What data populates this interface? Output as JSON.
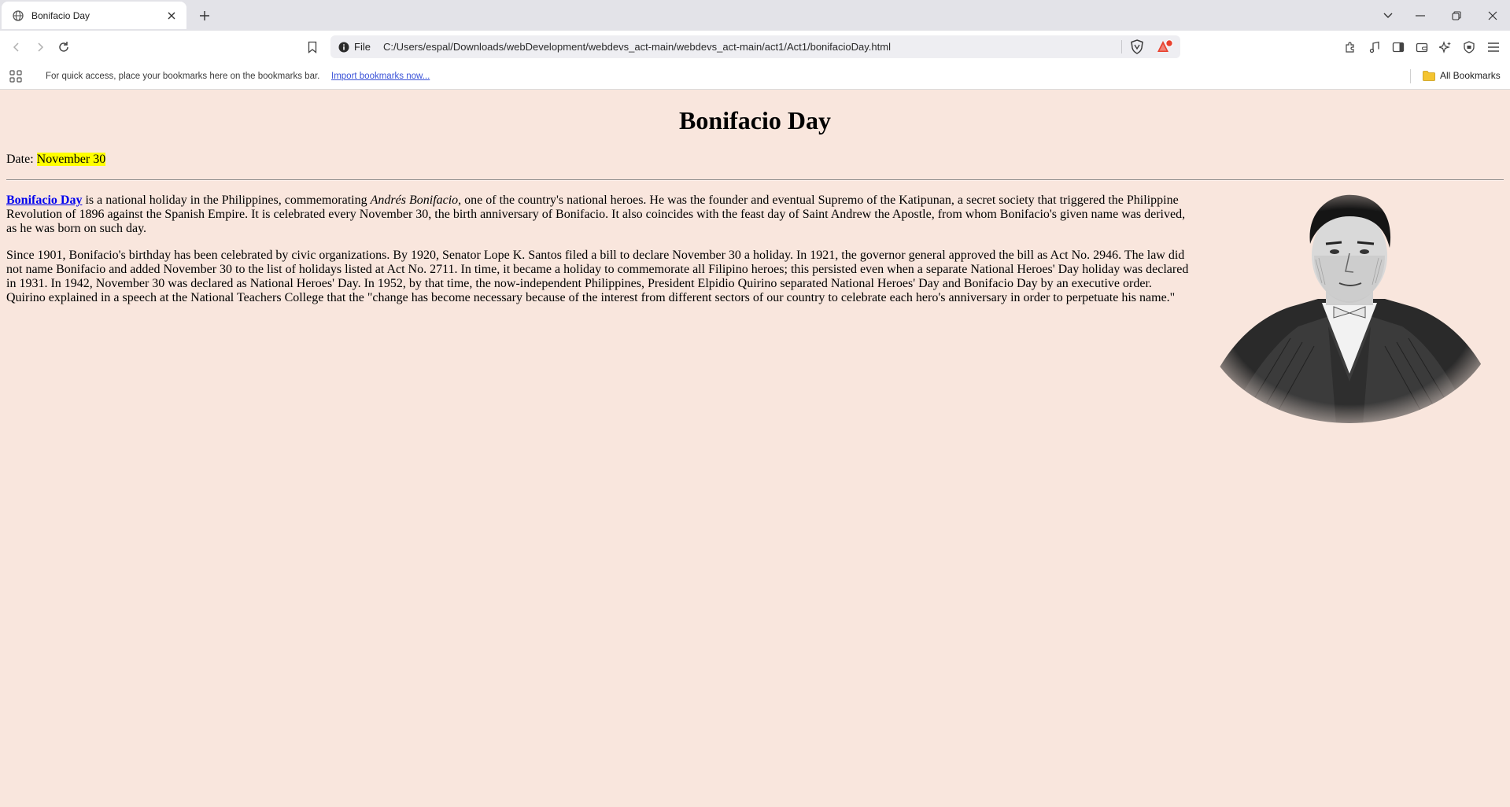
{
  "browser": {
    "tab": {
      "title": "Bonifacio Day"
    },
    "omnibox": {
      "scheme": "File",
      "url": "C:/Users/espal/Downloads/webDevelopment/webdevs_act-main/webdevs_act-main/act1/Act1/bonifacioDay.html"
    },
    "bookmarks_bar": {
      "prompt": "For quick access, place your bookmarks here on the bookmarks bar.",
      "import_link": "Import bookmarks now...",
      "all_bookmarks": "All Bookmarks"
    },
    "icons": {
      "tab": [
        "globe-icon",
        "close-icon",
        "plus-icon"
      ],
      "window": [
        "chevron-down-icon",
        "minimize-icon",
        "restore-icon",
        "close-window-icon"
      ],
      "nav": [
        "back-icon",
        "forward-icon",
        "reload-icon",
        "bookmark-icon",
        "info-icon",
        "brave-shields-icon",
        "brave-rewards-icon"
      ],
      "right_toolbar": [
        "extensions-icon",
        "media-icon",
        "sidebar-icon",
        "wallet-icon",
        "leo-ai-icon",
        "vpn-icon",
        "menu-icon"
      ],
      "bookmarks": [
        "apps-grid-icon",
        "folder-icon"
      ]
    }
  },
  "page": {
    "title": "Bonifacio Day",
    "date_label": "Date: ",
    "date_value": "November 30",
    "p1": {
      "link": "Bonifacio Day",
      "text_a": " is a national holiday in the Philippines, commemorating ",
      "italic": "Andrés Bonifacio",
      "text_b": ", one of the country's national heroes. He was the founder and eventual Supremo of the Katipunan, a secret society that triggered the Philippine Revolution of 1896 against the Spanish Empire. It is celebrated every November 30, the birth anniversary of Bonifacio. It also coincides with the feast day of Saint Andrew the Apostle, from whom Bonifacio's given name was derived, as he was born on such day."
    },
    "p2": "Since 1901, Bonifacio's birthday has been celebrated by civic organizations. By 1920, Senator Lope K. Santos filed a bill to declare November 30 a holiday. In 1921, the governor general approved the bill as Act No. 2946. The law did not name Bonifacio and added November 30 to the list of holidays listed at Act No. 2711. In time, it became a holiday to commemorate all Filipino heroes; this persisted even when a separate National Heroes' Day holiday was declared in 1931. In 1942, November 30 was declared as National Heroes' Day. In 1952, by that time, the now-independent Philippines, President Elpidio Quirino separated National Heroes' Day and Bonifacio Day by an executive order. Quirino explained in a speech at the National Teachers College that the \"change has become necessary because of the interest from different sectors of our country to celebrate each hero's anniversary in order to perpetuate his name.\""
  },
  "colors": {
    "page_bg": "#f9e6dd",
    "highlight": "#ffff00",
    "link": "#0000ee",
    "tabbar_bg": "#e3e3e8",
    "rewards_badge": "#e8412e"
  }
}
